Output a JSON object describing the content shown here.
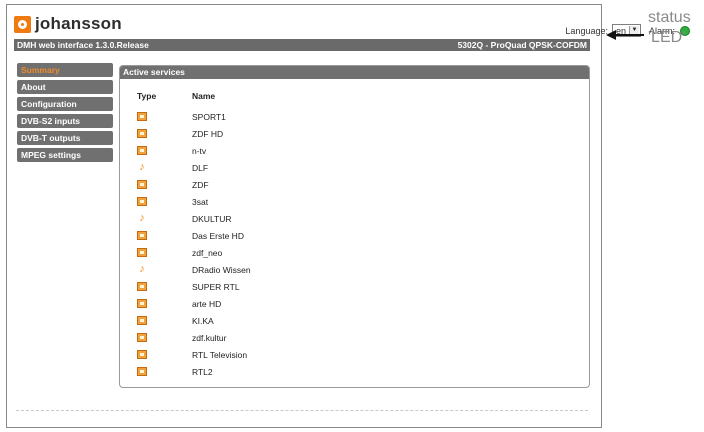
{
  "brand": {
    "logo_text": "johansson"
  },
  "header": {
    "language_label": "Language:",
    "language_value": "en",
    "alarm_label": "Alarm:",
    "alarm_color": "#2fae3d"
  },
  "titlebar": {
    "left": "DMH web interface 1.3.0.Release",
    "right": "5302Q - ProQuad QPSK-COFDM"
  },
  "sidebar": {
    "items": [
      {
        "label": "Summary",
        "active": true
      },
      {
        "label": "About"
      },
      {
        "label": "Configuration"
      },
      {
        "label": "DVB-S2 inputs"
      },
      {
        "label": "DVB-T outputs"
      },
      {
        "label": "MPEG settings"
      }
    ]
  },
  "panel": {
    "title": "Active services",
    "col_type": "Type",
    "col_name": "Name",
    "services": [
      {
        "type": "tv-icon",
        "name": "SPORT1"
      },
      {
        "type": "tv-icon",
        "name": "ZDF HD"
      },
      {
        "type": "tv-icon",
        "name": "n-tv"
      },
      {
        "type": "radio-icon",
        "name": "DLF"
      },
      {
        "type": "tv-icon",
        "name": "ZDF"
      },
      {
        "type": "tv-icon",
        "name": "3sat"
      },
      {
        "type": "radio-icon",
        "name": "DKULTUR"
      },
      {
        "type": "tv-icon",
        "name": "Das Erste HD"
      },
      {
        "type": "tv-icon",
        "name": "zdf_neo"
      },
      {
        "type": "radio-icon",
        "name": "DRadio Wissen"
      },
      {
        "type": "tv-icon",
        "name": "SUPER RTL"
      },
      {
        "type": "tv-icon",
        "name": "arte HD"
      },
      {
        "type": "tv-icon",
        "name": "KI.KA"
      },
      {
        "type": "tv-icon",
        "name": "zdf.kultur"
      },
      {
        "type": "tv-icon",
        "name": "RTL Television"
      },
      {
        "type": "tv-icon",
        "name": "RTL2"
      }
    ]
  },
  "annotation": {
    "line1": "status",
    "line2": "'LED'"
  }
}
